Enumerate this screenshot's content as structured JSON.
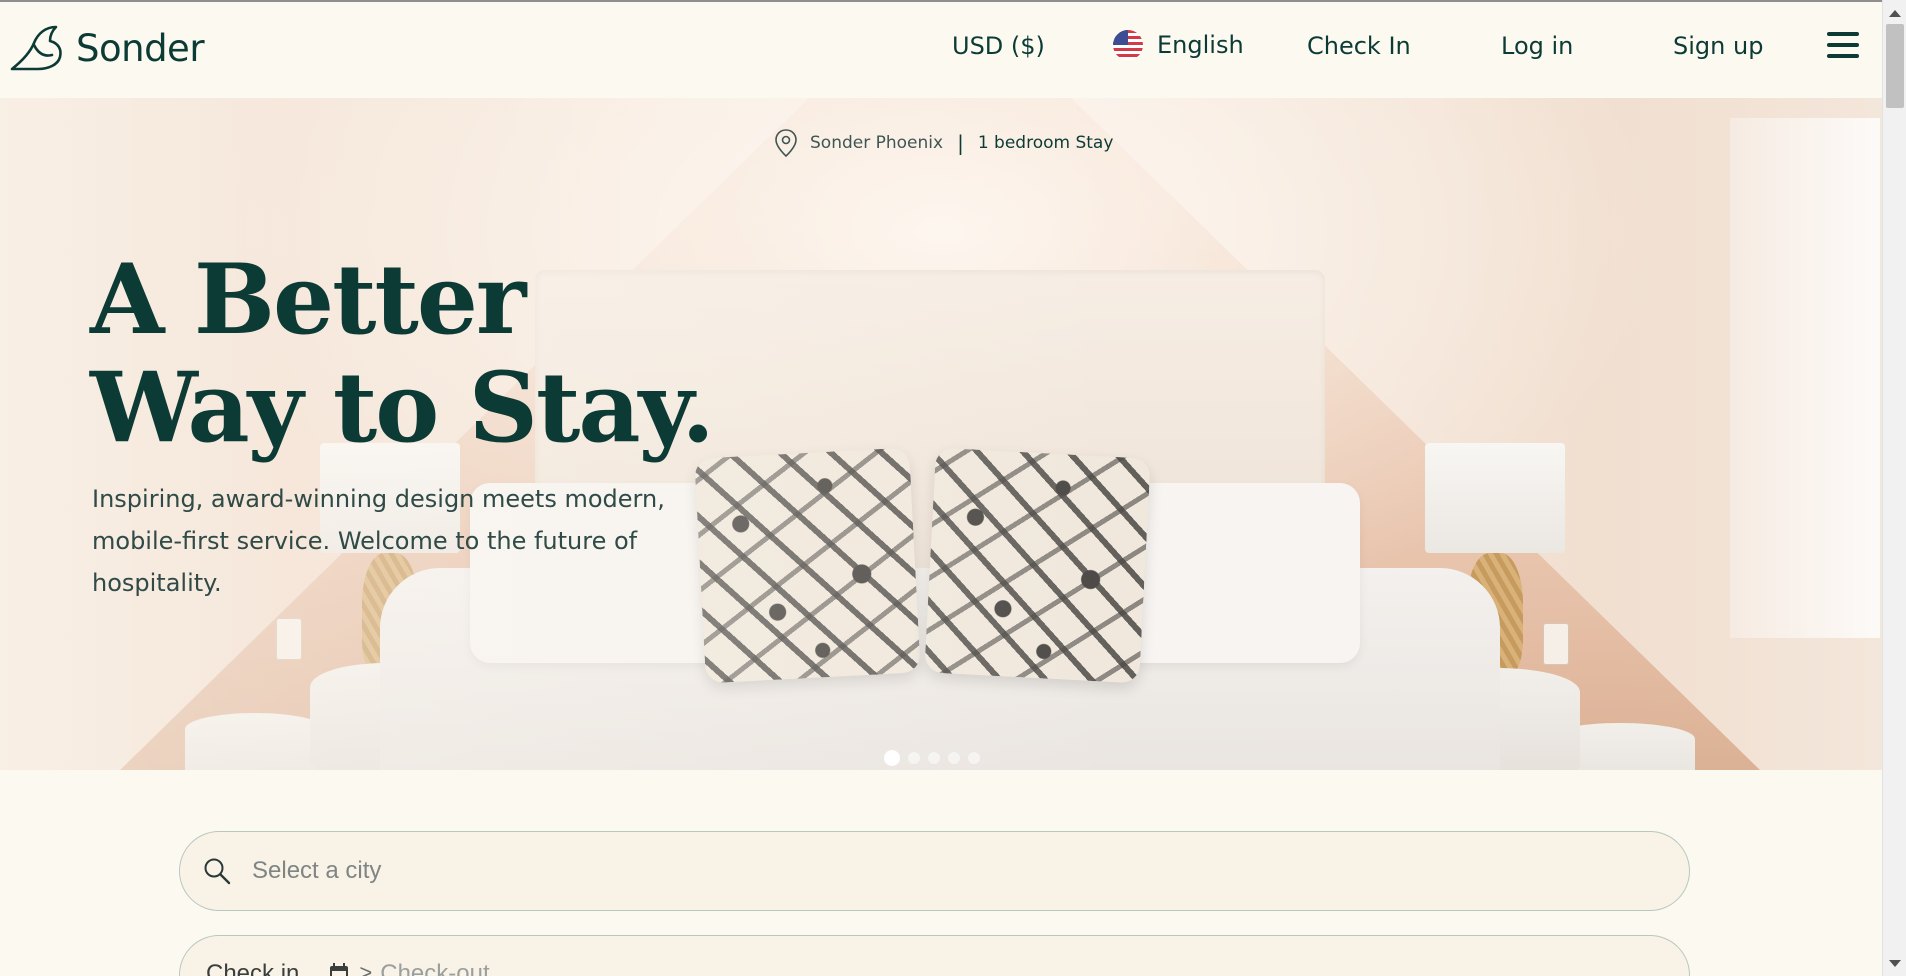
{
  "header": {
    "brand": "Sonder",
    "currency": "USD ($)",
    "language": "English",
    "check_in": "Check In",
    "log_in": "Log in",
    "sign_up": "Sign up"
  },
  "hero": {
    "location_city": "Sonder Phoenix",
    "location_separator": "|",
    "location_type": "1 bedroom Stay",
    "title_line1": "A Better",
    "title_line2": "Way to Stay.",
    "subtitle": "Inspiring, award-winning design meets modern, mobile-first service. Welcome to the future of hospitality.",
    "carousel": {
      "total": 5,
      "active_index": 0
    }
  },
  "search": {
    "city_placeholder": "Select a city",
    "check_in_label": "Check in",
    "check_out_label": "Check-out",
    "arrow": ">"
  },
  "colors": {
    "brand_green": "#0c3b36",
    "background": "#fcf9f1",
    "input_bg": "#f9f3e7",
    "input_border": "#b9c7bf"
  },
  "icons": [
    "sonder-logo-icon",
    "us-flag-icon",
    "hamburger-menu-icon",
    "location-pin-icon",
    "search-icon",
    "calendar-icon"
  ]
}
